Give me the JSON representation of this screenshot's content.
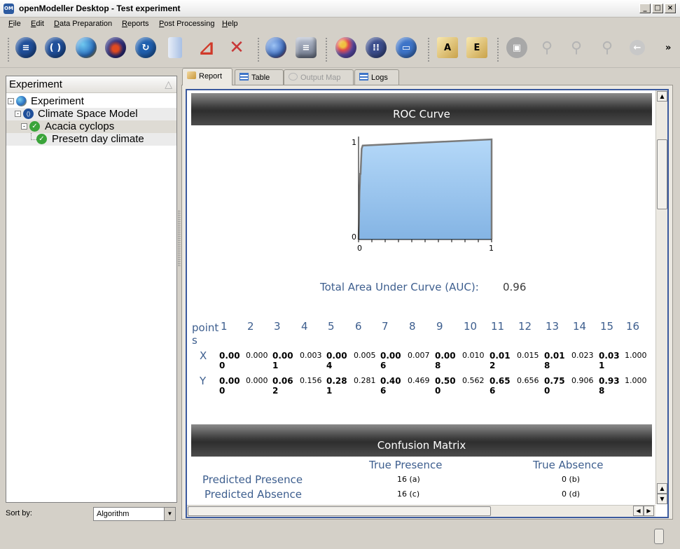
{
  "window": {
    "title": "openModeller Desktop - Test experiment",
    "app_icon_text": "OM"
  },
  "menu": [
    {
      "key": "F",
      "rest": "ile"
    },
    {
      "key": "E",
      "rest": "dit"
    },
    {
      "key": "D",
      "rest": "ata Preparation"
    },
    {
      "key": "R",
      "rest": "eports"
    },
    {
      "key": "P",
      "rest": "ost Processing"
    },
    {
      "key": "H",
      "rest": "elp"
    }
  ],
  "toolbar": {
    "overflow": "»",
    "buttons": [
      {
        "icon": "database-stack-icon",
        "color": "#1f4f9a"
      },
      {
        "icon": "algorithm-icon",
        "color": "#1f4f9a",
        "glyph": "( )"
      },
      {
        "icon": "globe-experiment-icon",
        "color": "#e8a21a"
      },
      {
        "icon": "layers-icon",
        "color": "#2b2b7a"
      },
      {
        "icon": "refresh-model-icon",
        "color": "#1f5fae"
      },
      {
        "icon": "document-icon",
        "color": "#c9d9f0"
      },
      {
        "icon": "pdf-icon",
        "color": "#d03a2a"
      },
      {
        "icon": "tools-icon",
        "color": "#c83838"
      },
      {
        "icon": "map-projection-icon",
        "color": "#3e6cc0"
      },
      {
        "icon": "database-icon",
        "color": "#8c95a8"
      },
      {
        "icon": "palette-icon",
        "color": "#5a4aa8"
      },
      {
        "icon": "rain-model-icon",
        "color": "#3b4d8c"
      },
      {
        "icon": "window-icon",
        "color": "#3d74c8"
      },
      {
        "icon": "annotate-a-icon",
        "color": "#c9a24a",
        "glyph": "A"
      },
      {
        "icon": "annotate-e-icon",
        "color": "#c9a24a",
        "glyph": "E"
      },
      {
        "icon": "camera-icon",
        "color": "#a8a8a8"
      },
      {
        "icon": "zoom-in-icon",
        "color": "#c8c8c8"
      },
      {
        "icon": "zoom-out-icon",
        "color": "#c8c8c8"
      },
      {
        "icon": "zoom-full-icon",
        "color": "#c8c8c8"
      },
      {
        "icon": "back-arrow-icon",
        "color": "#c8c8c8",
        "glyph": "←"
      }
    ]
  },
  "left_panel": {
    "header": "Experiment",
    "sort_indicator": "△",
    "tree": [
      {
        "label": "Experiment",
        "icon": "globe-icon",
        "expander": "-"
      },
      {
        "label": "Climate Space Model",
        "icon": "algorithm-icon",
        "expander": "-"
      },
      {
        "label": "Acacia cyclops",
        "icon": "check-icon",
        "expander": "-"
      },
      {
        "label": "Presetn day climate",
        "icon": "check-icon",
        "expander": ""
      }
    ],
    "sort_by_label": "Sort by:",
    "sort_by_value": "Algorithm"
  },
  "tabs": [
    {
      "label": "Report",
      "icon": "report-icon",
      "state": "active"
    },
    {
      "label": "Table",
      "icon": "table-icon",
      "state": "normal"
    },
    {
      "label": "Output Map",
      "icon": "map-icon",
      "state": "disabled"
    },
    {
      "label": "Logs",
      "icon": "logs-icon",
      "state": "normal"
    }
  ],
  "report": {
    "roc_title": "ROC Curve",
    "auc_label": "Total Area Under Curve (AUC):",
    "auc_value": "0.96",
    "points_label": "points",
    "x_label": "X",
    "y_label": "Y",
    "point_numbers": [
      "1",
      "2",
      "3",
      "4",
      "5",
      "6",
      "7",
      "8",
      "9",
      "10",
      "11",
      "12",
      "13",
      "14",
      "15",
      "16"
    ],
    "x_values": [
      "0.000",
      "0.000",
      "0.001",
      "0.003",
      "0.004",
      "0.005",
      "0.006",
      "0.007",
      "0.008",
      "0.010",
      "0.012",
      "0.015",
      "0.018",
      "0.023",
      "0.031",
      "1.000"
    ],
    "y_values": [
      "0.000",
      "0.000",
      "0.062",
      "0.156",
      "0.281",
      "0.281",
      "0.406",
      "0.469",
      "0.500",
      "0.562",
      "0.656",
      "0.656",
      "0.750",
      "0.906",
      "0.938",
      "1.000"
    ],
    "confusion_title": "Confusion Matrix",
    "true_presence": "True Presence",
    "true_absence": "True Absence",
    "predicted_presence": "Predicted Presence",
    "predicted_absence": "Predicted Absence",
    "a": "16 (a)",
    "b": "0 (b)",
    "c": "16 (c)",
    "d": "0 (d)"
  },
  "chart_data": {
    "type": "area",
    "title": "",
    "xlabel": "",
    "ylabel": "",
    "xlim": [
      0,
      1
    ],
    "ylim": [
      0,
      1
    ],
    "x_ticks": [
      "0",
      "1"
    ],
    "y_ticks": [
      "0",
      "1"
    ],
    "series": [
      {
        "x": [
          0.0,
          0.0,
          0.001,
          0.003,
          0.004,
          0.005,
          0.006,
          0.007,
          0.008,
          0.01,
          0.012,
          0.015,
          0.018,
          0.023,
          0.031,
          1.0
        ],
        "y": [
          0.0,
          0.0,
          0.062,
          0.156,
          0.281,
          0.281,
          0.406,
          0.469,
          0.5,
          0.562,
          0.656,
          0.656,
          0.75,
          0.906,
          0.938,
          1.0
        ]
      }
    ],
    "fill_color": "#a9cff4",
    "line_color": "#7a7a7a"
  }
}
